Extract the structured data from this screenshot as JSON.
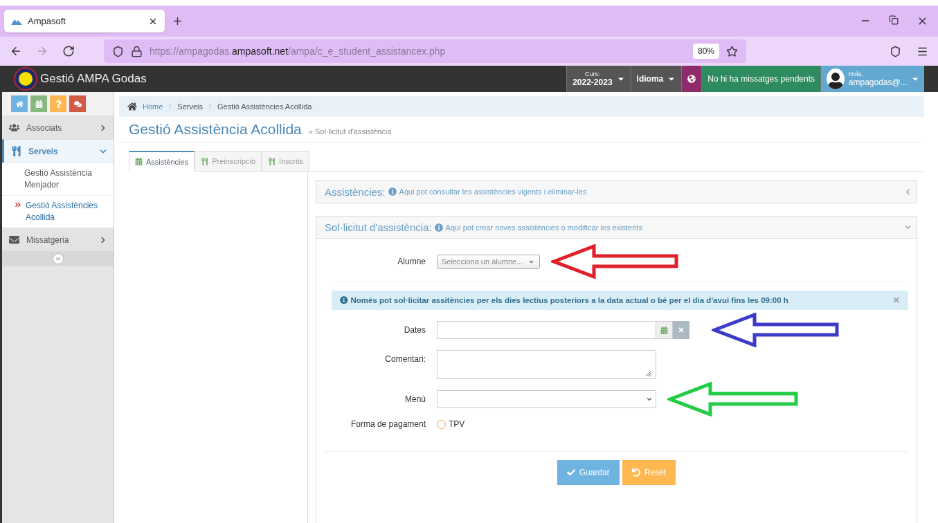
{
  "browser": {
    "tab_title": "Ampasoft",
    "nav_buttons": [
      {
        "kind": "back",
        "disabled": false
      },
      {
        "kind": "forward",
        "disabled": true
      },
      {
        "kind": "reload",
        "disabled": false
      }
    ],
    "url": "https://ampagodas.**ampasoft.net**/ampa/c_e_student_assistancex.php",
    "zoom": "80%"
  },
  "app_header": {
    "title": "Gestió AMPA Godas",
    "course_label": "Curs:",
    "course": "2022-2023",
    "language": "Idioma",
    "messages": "No hi ha missatges pendents",
    "greeting": "Hola,",
    "user": "ampagodas@..."
  },
  "sidebar": {
    "quick_buttons": [
      {
        "kind": "home",
        "color": "#6fb3e0"
      },
      {
        "kind": "calendar",
        "color": "#87b87f"
      },
      {
        "kind": "help",
        "color": "#ffb752"
      },
      {
        "kind": "messages",
        "color": "#d15b47"
      }
    ],
    "items": [
      {
        "label": "Associats",
        "kind": "users",
        "selected": false,
        "expanded": false
      },
      {
        "label": "Serveis",
        "kind": "utensils",
        "selected": true,
        "expanded": true,
        "children": [
          {
            "label": "Gestió Assistència Menjador",
            "selected": false
          },
          {
            "label": "Gestió Assistències Acollida",
            "selected": true
          }
        ]
      },
      {
        "label": "Missatgeria",
        "kind": "envelope",
        "selected": false,
        "expanded": false
      }
    ]
  },
  "breadcrumb": [
    "Home",
    "Serveis",
    "Gestió Assistències Acollida"
  ],
  "page_title": "Gestió Assistència Acollida",
  "page_subtitle": "» Sol·licitut d'assistència",
  "tabs": [
    {
      "label": "Assistències",
      "kind": "calendar",
      "selected": true
    },
    {
      "label": "Preinscripció",
      "kind": "utensils",
      "selected": false
    },
    {
      "label": "Inscrits",
      "kind": "utensils",
      "selected": false
    }
  ],
  "panels": [
    {
      "title": "Assistències:",
      "hint": "Aqui pot consultar les assistències vigents i eliminar-les",
      "expanded": false
    },
    {
      "title": "Sol·licitut d'assistència:",
      "hint": "Aqui pot crear noves assistències o modificar les existents",
      "expanded": true
    }
  ],
  "form": {
    "rows": [
      {
        "kind": "select_small",
        "label": "Alumne",
        "placeholder": "Selecciona un alumne...",
        "arrow": {
          "color": "#e0202a"
        }
      },
      {
        "kind": "divider"
      },
      {
        "kind": "alert",
        "text": "Només pot sol·licitar assitències per els dies lectius posteriors a la data actual o bé per el dia d'avui fins les 09:00 h"
      },
      {
        "kind": "date",
        "label": "Dates",
        "arrow": {
          "color": "#3c3cc8"
        }
      },
      {
        "kind": "textarea",
        "label": "Comentari:"
      },
      {
        "kind": "select",
        "label": "Menú",
        "arrow": {
          "color": "#22cc44"
        }
      },
      {
        "kind": "radio",
        "label": "Forma de pagament",
        "options": [
          {
            "label": "TPV",
            "checked": false
          }
        ]
      }
    ],
    "buttons": [
      {
        "kind": "save",
        "label": "Guardar"
      },
      {
        "kind": "reset",
        "label": "Reset"
      }
    ]
  }
}
